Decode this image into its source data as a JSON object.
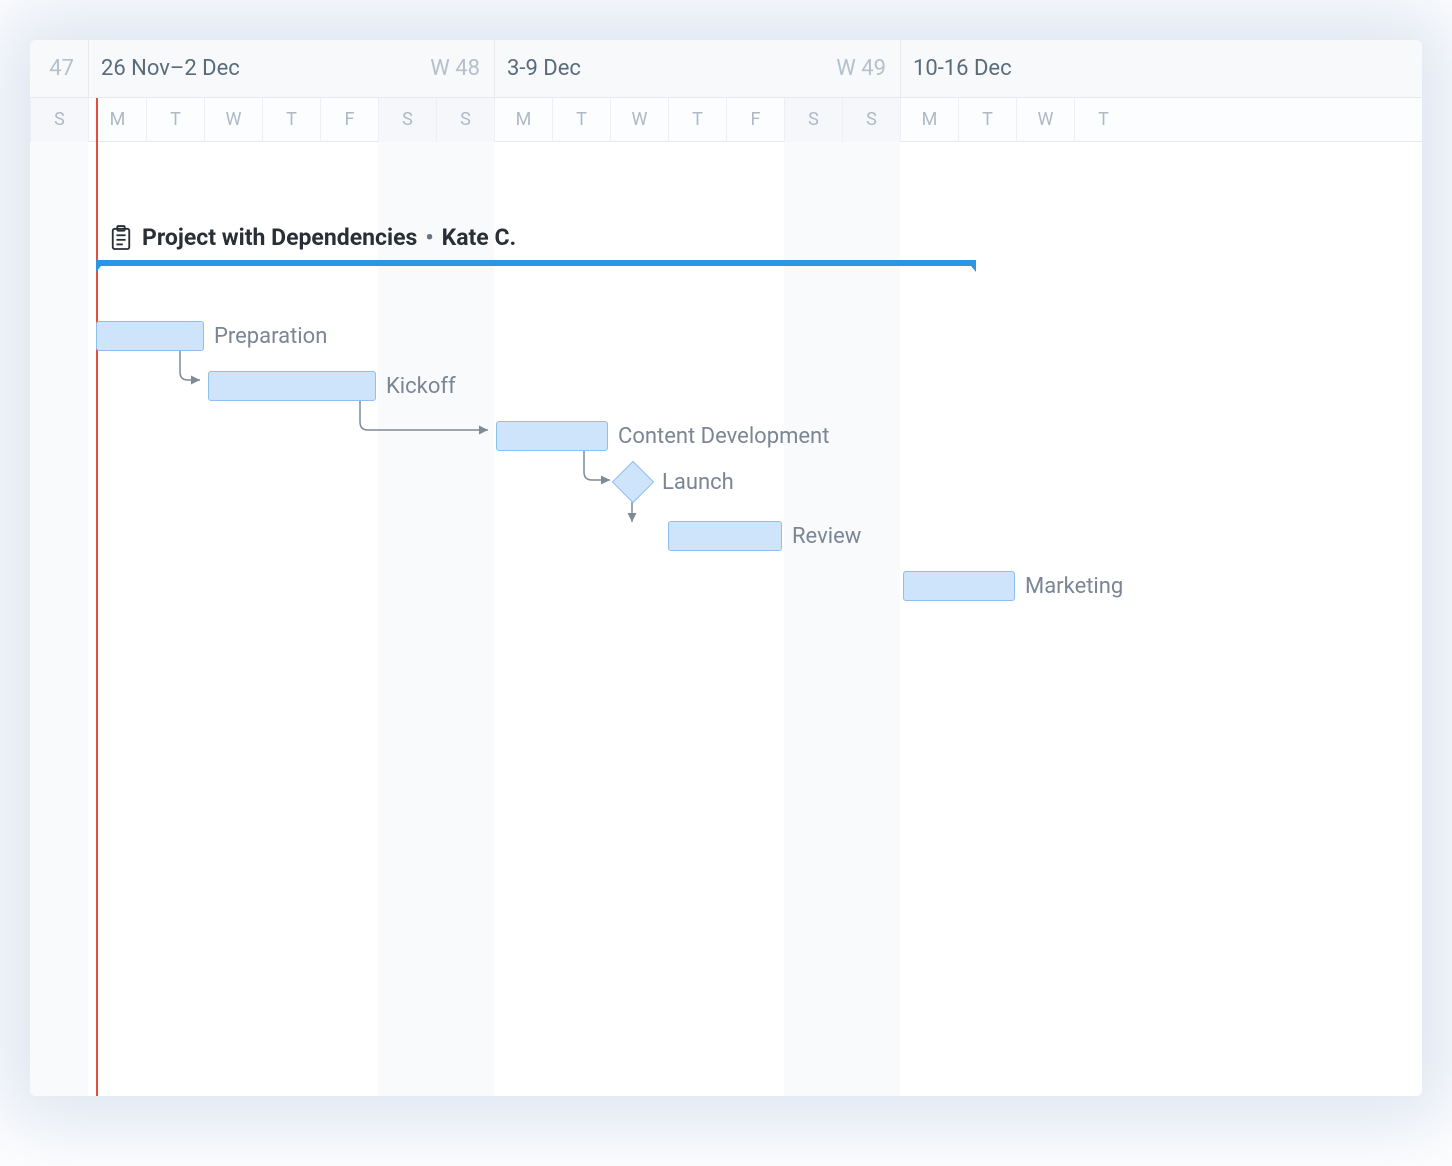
{
  "timeline": {
    "prev_week_num": "47",
    "weeks": [
      {
        "range": "26 Nov–2 Dec",
        "num": "W 48"
      },
      {
        "range": "3-9 Dec",
        "num": "W 49"
      },
      {
        "range": "10-16 Dec",
        "num": ""
      }
    ],
    "days": [
      "S",
      "M",
      "T",
      "W",
      "T",
      "F",
      "S",
      "S",
      "M",
      "T",
      "W",
      "T",
      "F",
      "S",
      "S",
      "M",
      "T",
      "W",
      "T"
    ]
  },
  "project": {
    "title": "Project with Dependencies",
    "owner": "Kate C."
  },
  "tasks": {
    "preparation": "Preparation",
    "kickoff": "Kickoff",
    "content_dev": "Content Development",
    "launch": "Launch",
    "review": "Review",
    "marketing": "Marketing"
  },
  "chart_data": {
    "type": "gantt",
    "title": "Project with Dependencies",
    "owner": "Kate C.",
    "timeline_start": "2018-11-25",
    "timeline_end": "2018-12-13",
    "today": "2018-11-26",
    "project_span": {
      "start": "2018-11-26",
      "end": "2018-12-11"
    },
    "tasks": [
      {
        "id": "preparation",
        "name": "Preparation",
        "type": "task",
        "start": "2018-11-26",
        "end": "2018-11-27",
        "row": 0
      },
      {
        "id": "kickoff",
        "name": "Kickoff",
        "type": "task",
        "start": "2018-11-28",
        "end": "2018-11-30",
        "row": 1,
        "depends_on": [
          "preparation"
        ]
      },
      {
        "id": "content_dev",
        "name": "Content Development",
        "type": "task",
        "start": "2018-12-03",
        "end": "2018-12-04",
        "row": 2,
        "depends_on": [
          "kickoff"
        ]
      },
      {
        "id": "launch",
        "name": "Launch",
        "type": "milestone",
        "date": "2018-12-05",
        "row": 3,
        "depends_on": [
          "content_dev"
        ]
      },
      {
        "id": "review",
        "name": "Review",
        "type": "task",
        "start": "2018-12-06",
        "end": "2018-12-07",
        "row": 4,
        "depends_on": [
          "launch"
        ]
      },
      {
        "id": "marketing",
        "name": "Marketing",
        "type": "task",
        "start": "2018-12-10",
        "end": "2018-12-11",
        "row": 5
      }
    ]
  }
}
